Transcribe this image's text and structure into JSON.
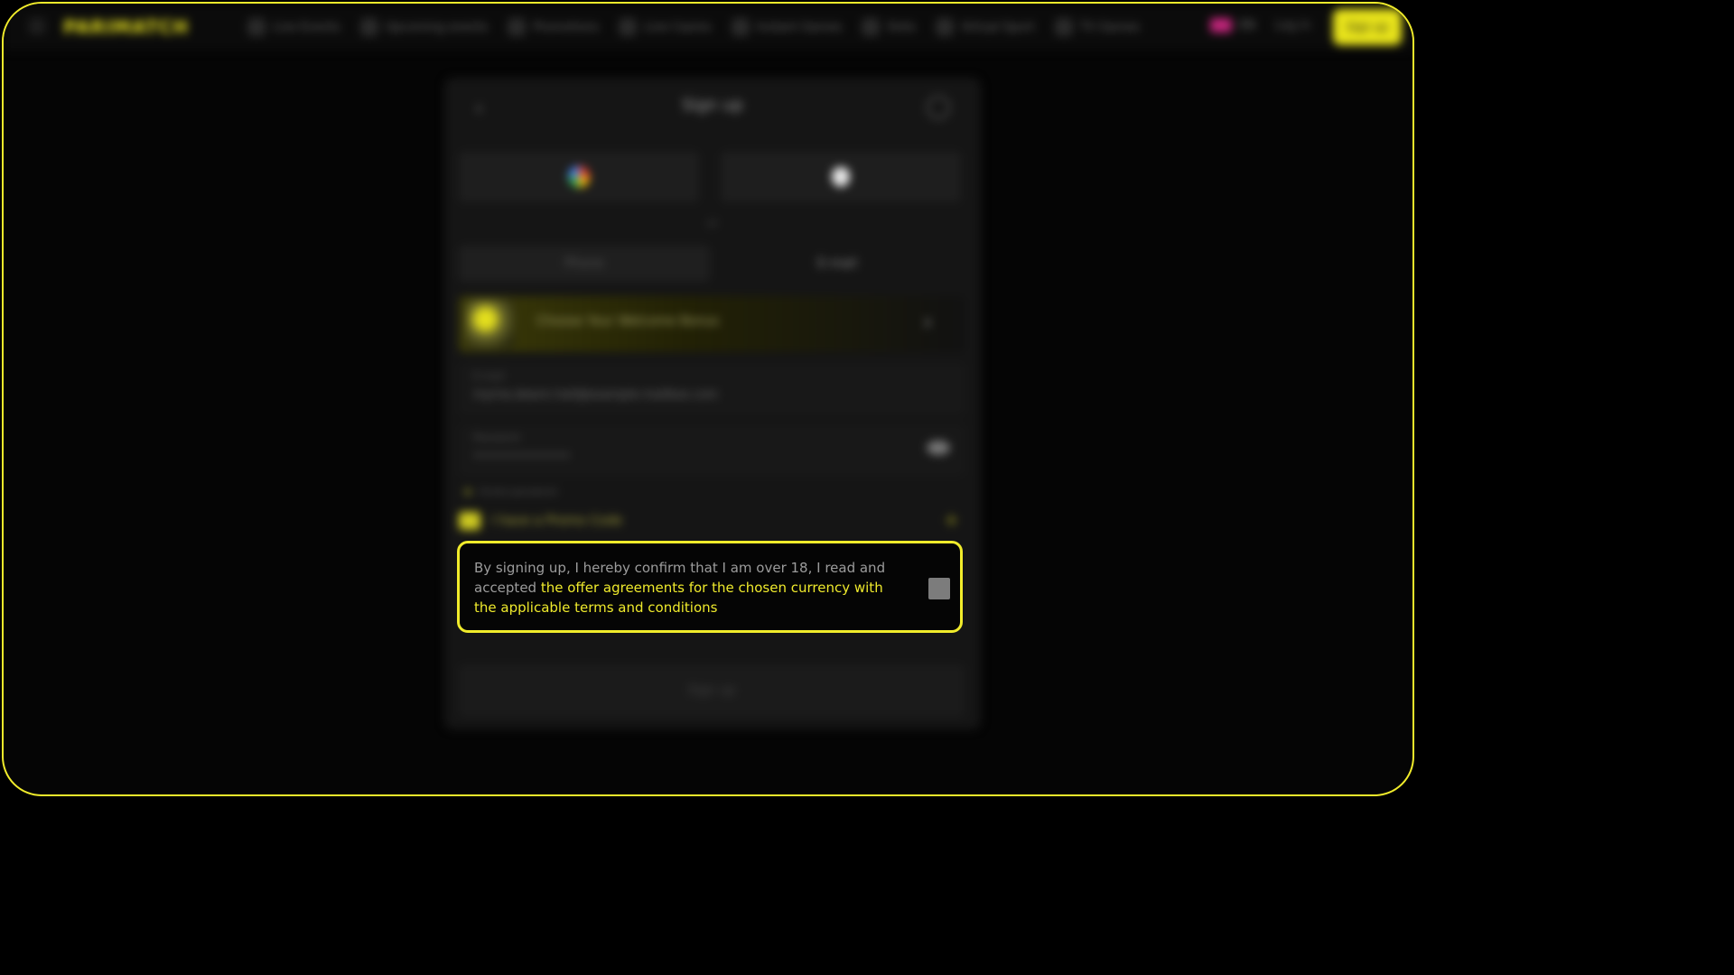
{
  "header": {
    "logo": "PARIMATCH",
    "nav": [
      "Live Events",
      "Upcoming events",
      "Promotions",
      "Live Casino",
      "Instant Games",
      "Slots",
      "Virtual Sport",
      "TV Games"
    ],
    "lang": "EN",
    "login_label": "Log in",
    "signup_label": "Sign up"
  },
  "modal": {
    "title": "Sign up",
    "or_label": "or",
    "tabs": [
      "Phone",
      "E-mail"
    ],
    "bonus_label": "Choose Your Welcome Bonus",
    "email_label": "E-mail",
    "email_value": "myrna.deann.hall@example-mailbox.com",
    "password_label": "Password",
    "password_value": "••••••••••••••",
    "strength_label": "Great password",
    "promo_label": "I have a Promo Code",
    "submit_label": "Sign up"
  },
  "consent": {
    "text_plain": "By signing up, I hereby confirm that I am over 18, I read and accepted ",
    "text_link": "the offer agreements for the chosen currency with the applicable terms and conditions",
    "checked": false
  },
  "colors": {
    "accent": "#f1ec2b",
    "text_muted": "#9c9c9c",
    "checkbox": "#7c7c7c"
  }
}
